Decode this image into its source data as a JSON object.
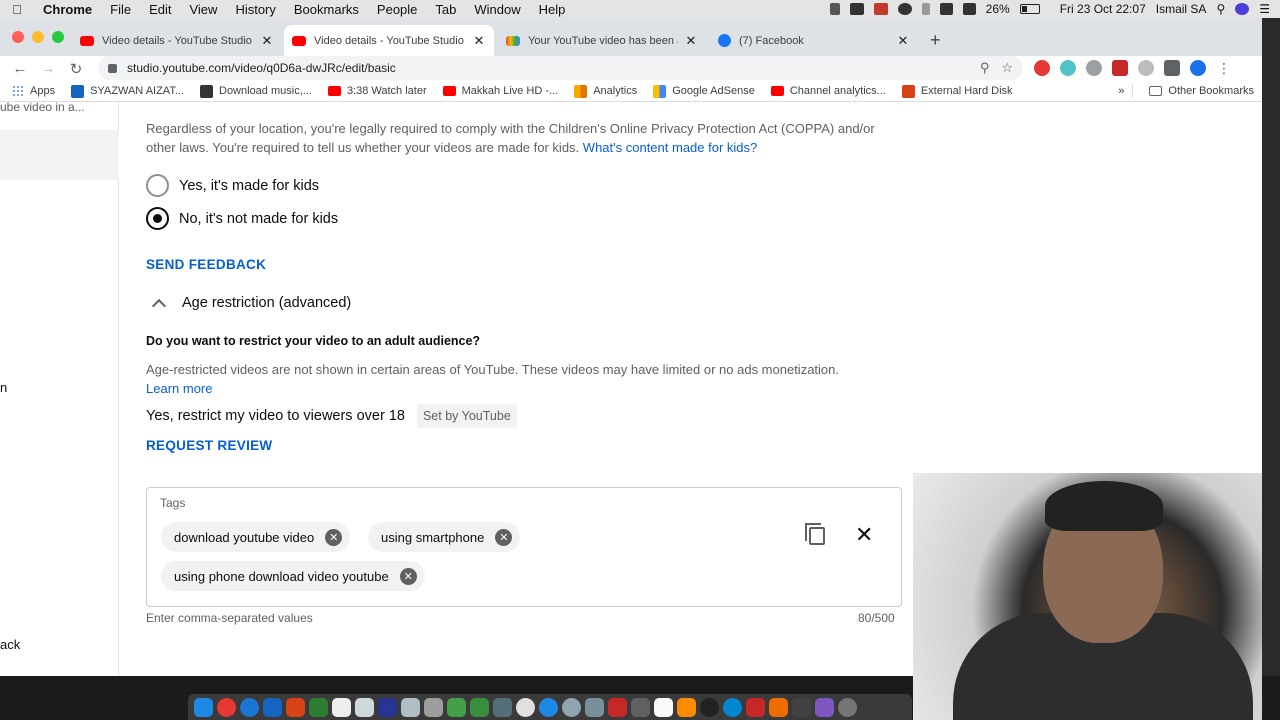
{
  "menubar": {
    "app": "Chrome",
    "items": [
      "File",
      "Edit",
      "View",
      "History",
      "Bookmarks",
      "People",
      "Tab",
      "Window",
      "Help"
    ],
    "battery": "26%",
    "datetime": "Fri 23 Oct  22:07",
    "user": "Ismail SA"
  },
  "tabs": [
    {
      "label": "Video details - YouTube Studio",
      "icon": "youtube-icon",
      "active": false
    },
    {
      "label": "Video details - YouTube Studio",
      "icon": "youtube-icon",
      "active": true
    },
    {
      "label": "Your YouTube video has been a",
      "icon": "gmail-icon",
      "active": false
    },
    {
      "label": "(7) Facebook",
      "icon": "facebook-icon",
      "active": false
    }
  ],
  "address": {
    "url": "studio.youtube.com/video/q0D6a-dwJRc/edit/basic"
  },
  "bookmarks": [
    {
      "label": "Apps"
    },
    {
      "label": "SYAZWAN AIZAT..."
    },
    {
      "label": "Download music,..."
    },
    {
      "label": "3:38 Watch later"
    },
    {
      "label": "Makkah Live HD -..."
    },
    {
      "label": "Analytics"
    },
    {
      "label": "Google AdSense"
    },
    {
      "label": "Channel analytics..."
    },
    {
      "label": "External Hard Disk"
    }
  ],
  "bookmarks_more": "»",
  "other_bookmarks": "Other Bookmarks",
  "leftnav": {
    "frag1": "ube video in a...",
    "frag2": "n",
    "frag3": "ack"
  },
  "content": {
    "coppa_text": "Regardless of your location, you're legally required to comply with the Children's Online Privacy Protection Act (COPPA) and/or other laws. You're required to tell us whether your videos are made for kids.",
    "coppa_link": "What's content made for kids?",
    "radio_yes": "Yes, it's made for kids",
    "radio_no": "No, it's not made for kids",
    "send_feedback": "SEND FEEDBACK",
    "age_section": "Age restriction (advanced)",
    "age_question": "Do you want to restrict your video to an adult audience?",
    "age_text": "Age-restricted videos are not shown in certain areas of YouTube. These videos may have limited or no ads monetization.",
    "learn_more": "Learn more",
    "restrict_label": "Yes, restrict my video to viewers over 18",
    "set_by": "Set by YouTube",
    "request_review": "REQUEST REVIEW",
    "tags_label": "Tags",
    "tags": [
      "download youtube video",
      "using smartphone",
      "using phone download video youtube"
    ],
    "helper": "Enter comma-separated values",
    "count": "80/500"
  }
}
